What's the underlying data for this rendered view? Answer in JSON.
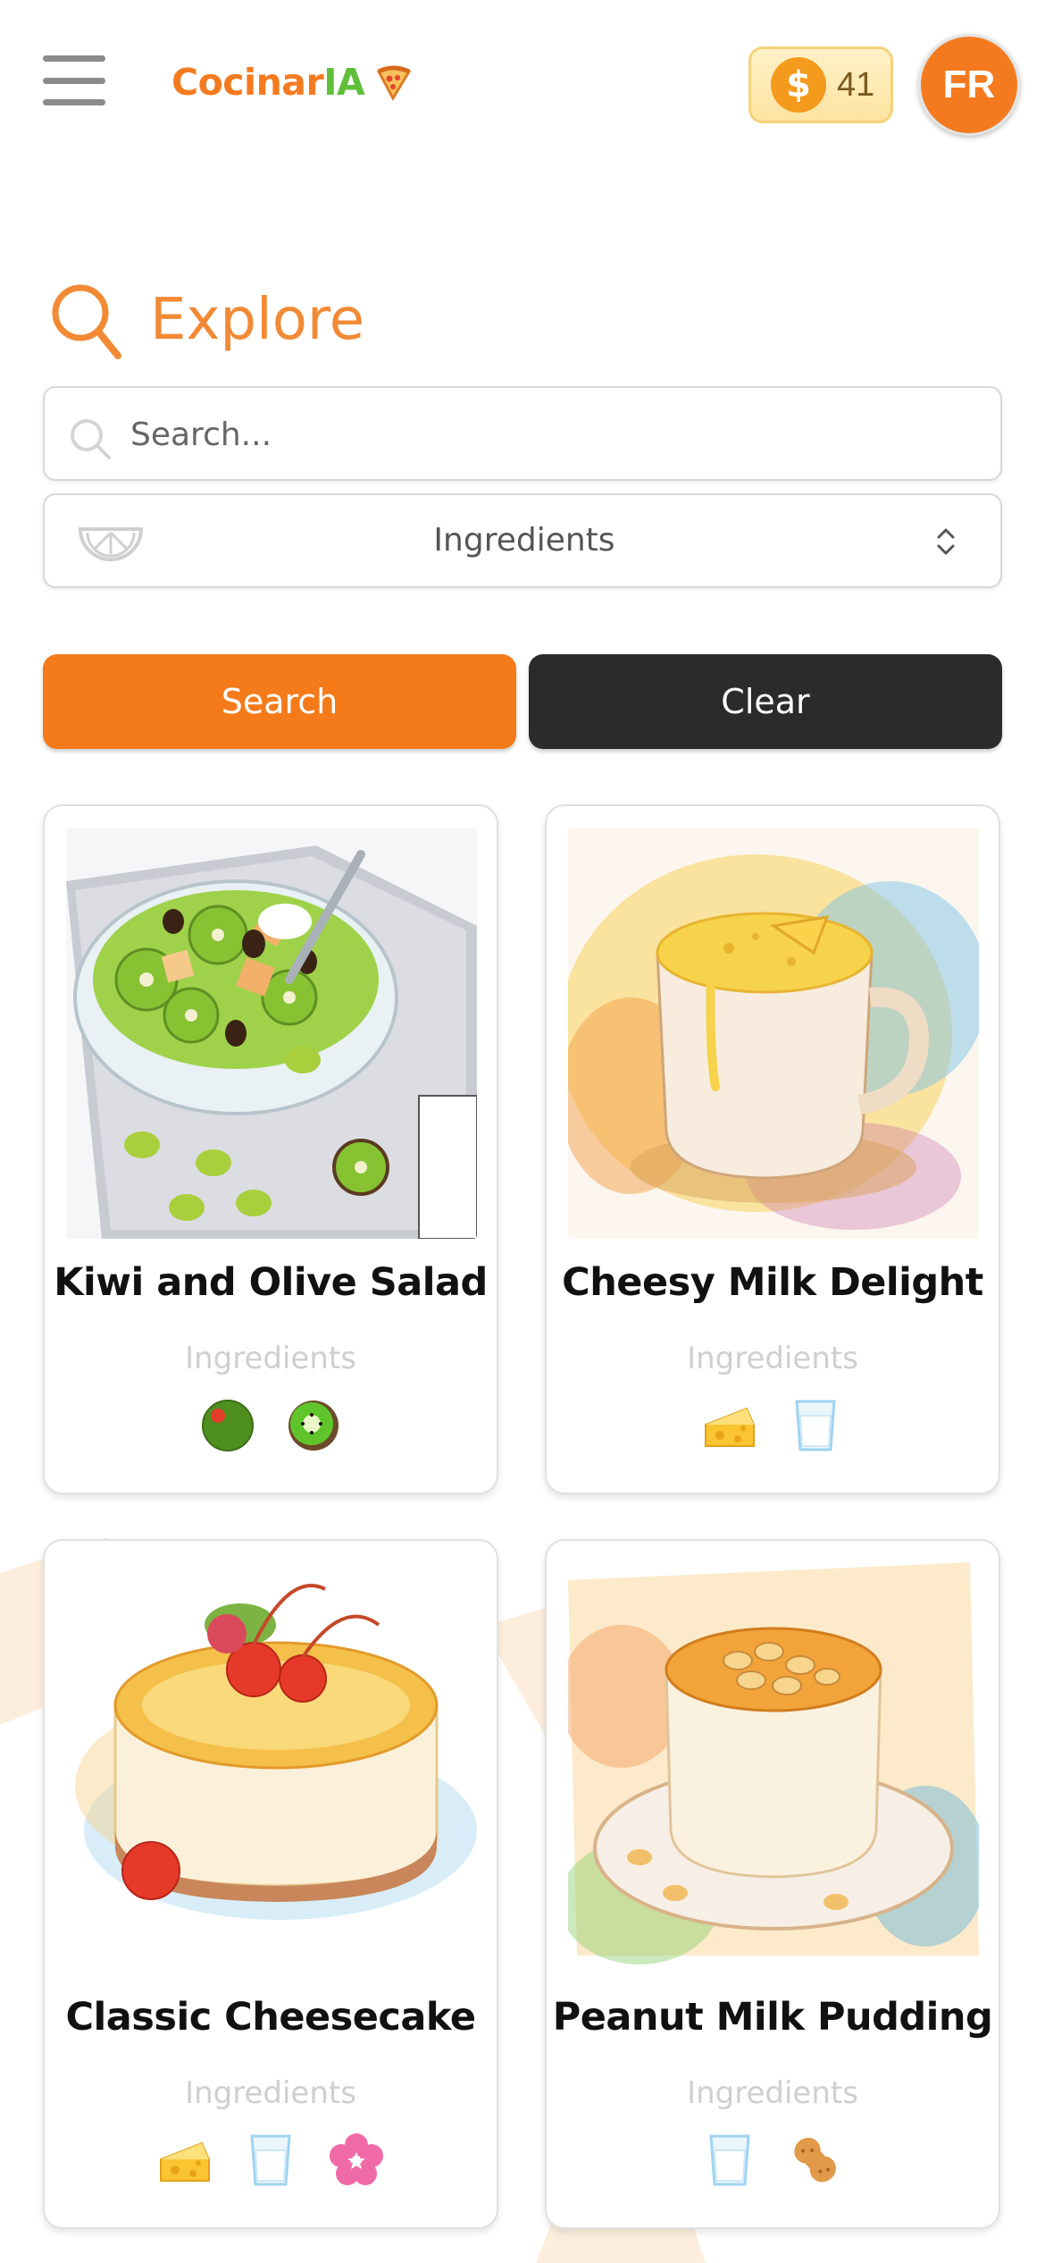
{
  "header": {
    "brand_main": "Cocinar",
    "brand_accent": "IA",
    "brand_icon": "pizza-icon",
    "coins": "41",
    "coin_symbol": "$",
    "avatar_initials": "FR"
  },
  "explore": {
    "title": "Explore",
    "icon": "search-icon"
  },
  "search": {
    "placeholder": "Search...",
    "value": ""
  },
  "filter": {
    "selected": "Ingredients",
    "icon": "lemon-slice-icon"
  },
  "buttons": {
    "search_label": "Search",
    "clear_label": "Clear"
  },
  "recipes": [
    {
      "title": "Kiwi and Olive Salad",
      "ingredients_label": "Ingredients",
      "ingredients": [
        "olive-icon",
        "kiwi-icon"
      ]
    },
    {
      "title": "Cheesy Milk Delight",
      "ingredients_label": "Ingredients",
      "ingredients": [
        "cheese-icon",
        "milk-glass-icon"
      ]
    },
    {
      "title": "Classic Cheesecake",
      "ingredients_label": "Ingredients",
      "ingredients": [
        "cheese-icon",
        "milk-glass-icon",
        "flower-icon"
      ]
    },
    {
      "title": "Peanut Milk Pudding",
      "ingredients_label": "Ingredients",
      "ingredients": [
        "milk-glass-icon",
        "peanut-icon"
      ]
    }
  ],
  "colors": {
    "accent": "#f47a1a",
    "brand_green": "#5fbf3a",
    "dark_button": "#2b2b2b",
    "muted_label": "#cfcfcf"
  }
}
